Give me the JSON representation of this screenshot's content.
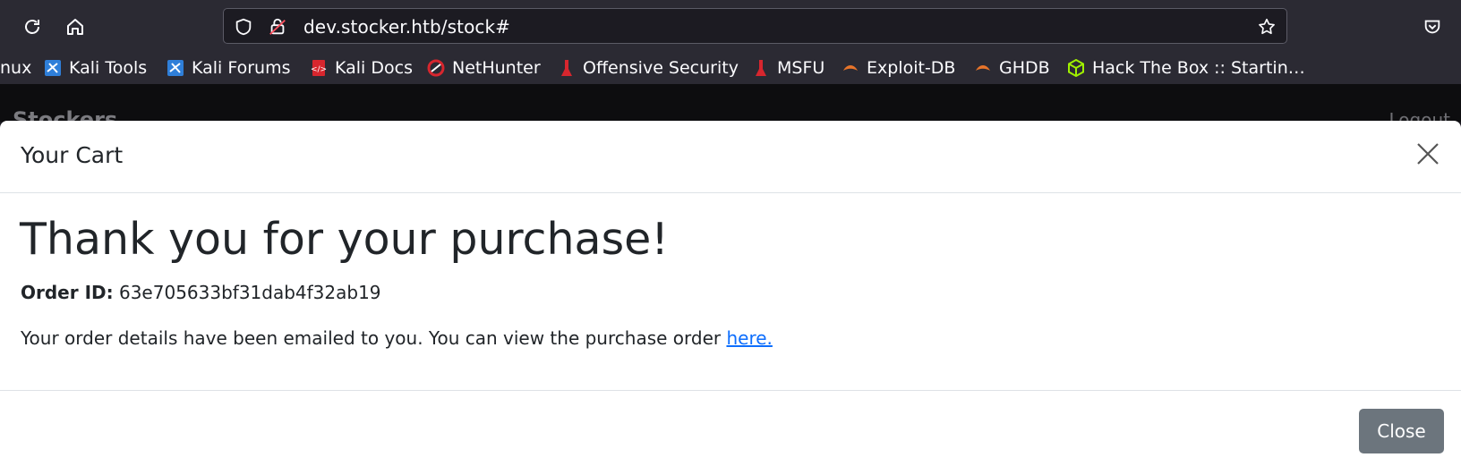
{
  "browser": {
    "url": "dev.stocker.htb/stock#",
    "bookmarks": [
      {
        "label": "nux",
        "icon": "kali-linux-icon"
      },
      {
        "label": "Kali Tools",
        "icon": "kali-tools-icon"
      },
      {
        "label": "Kali Forums",
        "icon": "kali-forums-icon"
      },
      {
        "label": "Kali Docs",
        "icon": "kali-docs-icon"
      },
      {
        "label": "NetHunter",
        "icon": "nethunter-icon"
      },
      {
        "label": "Offensive Security",
        "icon": "offsec-icon"
      },
      {
        "label": "MSFU",
        "icon": "msfu-icon"
      },
      {
        "label": "Exploit-DB",
        "icon": "exploitdb-icon"
      },
      {
        "label": "GHDB",
        "icon": "ghdb-icon"
      },
      {
        "label": "Hack The Box :: Startin…",
        "icon": "htb-icon"
      }
    ]
  },
  "page": {
    "brand": "Stockers",
    "logout": "Logout"
  },
  "modal": {
    "title": "Your Cart",
    "heading": "Thank you for your purchase!",
    "order_label": "Order ID:",
    "order_id": "63e705633bf31dab4f32ab19",
    "details_text": "Your order details have been emailed to you. You can view the purchase order ",
    "details_link": "here.",
    "close_button": "Close"
  },
  "colors": {
    "chrome_bg": "#2b2a33",
    "link": "#0d6efd",
    "secondary_button": "#6c757d"
  }
}
